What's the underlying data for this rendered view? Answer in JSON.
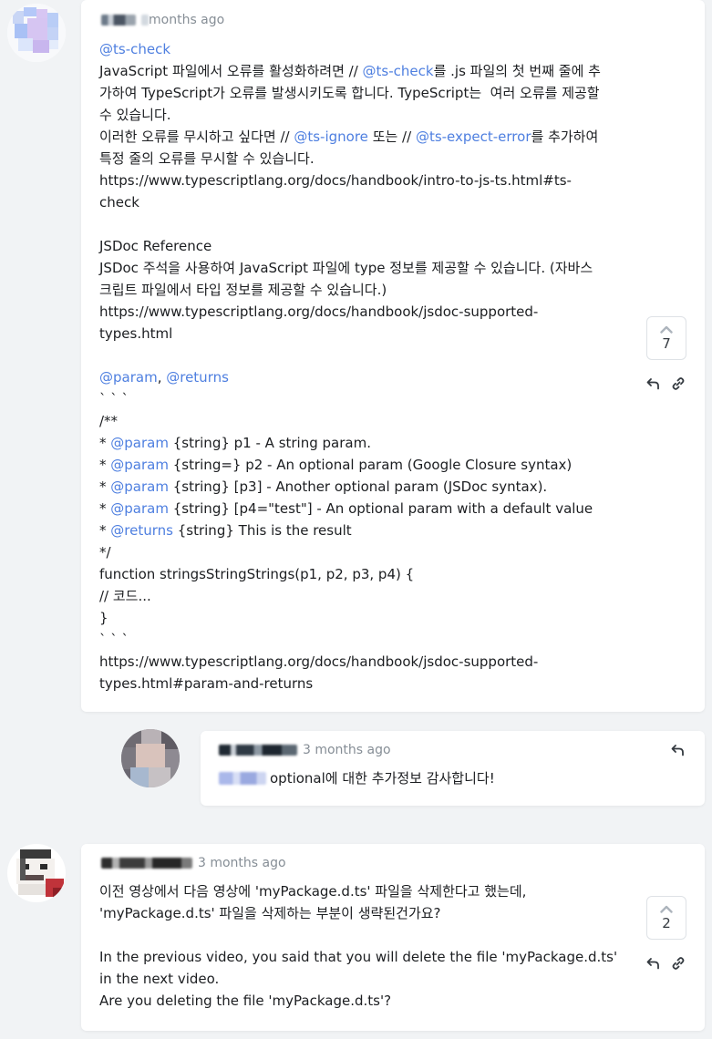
{
  "comments": [
    {
      "time": "months ago",
      "votes": "7",
      "lines": [
        [
          {
            "t": "@ts-check",
            "k": true
          }
        ],
        [
          {
            "t": "JavaScript 파일에서 오류를 활성화하려면 // "
          },
          {
            "t": "@ts-check",
            "k": true
          },
          {
            "t": "를 .js 파일의 첫 번째 줄에 추"
          }
        ],
        [
          {
            "t": "가하여 TypeScript가 오류를 발생시키도록 합니다. TypeScript는  여러 오류를 제공할"
          }
        ],
        [
          {
            "t": "수 있습니다."
          }
        ],
        [
          {
            "t": "이러한 오류를 무시하고 싶다면 // "
          },
          {
            "t": "@ts-ignore",
            "k": true
          },
          {
            "t": " 또는 // "
          },
          {
            "t": "@ts-expect-error",
            "k": true
          },
          {
            "t": "를 추가하여"
          }
        ],
        [
          {
            "t": "특정 줄의 오류를 무시할 수 있습니다."
          }
        ],
        [
          {
            "t": "https://www.typescriptlang.org/docs/handbook/intro-to-js-ts.html#ts-"
          }
        ],
        [
          {
            "t": "check"
          }
        ],
        [
          {
            "t": ""
          }
        ],
        [
          {
            "t": "JSDoc Reference"
          }
        ],
        [
          {
            "t": "JSDoc 주석을 사용하여 JavaScript 파일에 type 정보를 제공할 수 있습니다. (자바스"
          }
        ],
        [
          {
            "t": "크립트 파일에서 타입 정보를 제공할 수 있습니다.)"
          }
        ],
        [
          {
            "t": "https://www.typescriptlang.org/docs/handbook/jsdoc-supported-"
          }
        ],
        [
          {
            "t": "types.html"
          }
        ],
        [
          {
            "t": ""
          }
        ],
        [
          {
            "t": "@param",
            "k": true
          },
          {
            "t": ", "
          },
          {
            "t": "@returns",
            "k": true
          }
        ],
        [
          {
            "t": "` ` `"
          }
        ],
        [
          {
            "t": "/**"
          }
        ],
        [
          {
            "t": "* "
          },
          {
            "t": "@param",
            "k": true
          },
          {
            "t": " {string} p1 - A string param."
          }
        ],
        [
          {
            "t": "* "
          },
          {
            "t": "@param",
            "k": true
          },
          {
            "t": " {string=} p2 - An optional param (Google Closure syntax)"
          }
        ],
        [
          {
            "t": "* "
          },
          {
            "t": "@param",
            "k": true
          },
          {
            "t": " {string} [p3] - Another optional param (JSDoc syntax)."
          }
        ],
        [
          {
            "t": "* "
          },
          {
            "t": "@param",
            "k": true
          },
          {
            "t": " {string} [p4=\"test\"] - An optional param with a default value"
          }
        ],
        [
          {
            "t": "* "
          },
          {
            "t": "@returns",
            "k": true
          },
          {
            "t": " {string} This is the result"
          }
        ],
        [
          {
            "t": "*/"
          }
        ],
        [
          {
            "t": "function stringsStringStrings(p1, p2, p3, p4) {"
          }
        ],
        [
          {
            "t": "// 코드..."
          }
        ],
        [
          {
            "t": "}"
          }
        ],
        [
          {
            "t": "` ` `"
          }
        ],
        [
          {
            "t": "https://www.typescriptlang.org/docs/handbook/jsdoc-supported-"
          }
        ],
        [
          {
            "t": "types.html#param-and-returns"
          }
        ]
      ]
    },
    {
      "time": "3 months ago",
      "text": "optional에 대한 추가정보 감사합니다!"
    },
    {
      "time": "3 months ago",
      "votes": "2",
      "lines": [
        [
          {
            "t": "이전 영상에서 다음 영상에 'myPackage.d.ts' 파일을 삭제한다고 했는데,"
          }
        ],
        [
          {
            "t": "'myPackage.d.ts' 파일을 삭제하는 부분이 생략된건가요?"
          }
        ],
        [
          {
            "t": ""
          }
        ],
        [
          {
            "t": "In the previous video, you said that you will delete the file 'myPackage.d.ts'"
          }
        ],
        [
          {
            "t": "in the next video."
          }
        ],
        [
          {
            "t": "Are you deleting the file 'myPackage.d.ts'?"
          }
        ]
      ]
    }
  ],
  "colors": {
    "page_bg": "#f1f3f5",
    "card_bg": "#ffffff",
    "accent": "#4e7fe0",
    "muted": "#868e96"
  },
  "icons": {
    "upvote": "chevron-up-icon",
    "reply": "reply-arrow-icon",
    "link": "link-icon"
  }
}
